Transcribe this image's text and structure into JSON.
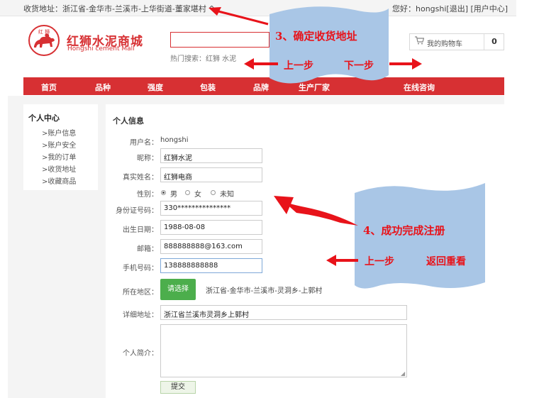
{
  "topbar": {
    "address_prefix": "收货地址：",
    "address": "浙江省-金华市-兰溪市-上华街道-董家堪村",
    "greeting": "您好：hongshi[退出] [用户中心]"
  },
  "logo": {
    "badge_text": "红 狮",
    "brand_cn": "红狮水泥商城",
    "brand_en": "Hongshi cement Mall"
  },
  "search": {
    "placeholder": "",
    "hot_label": "热门搜索：",
    "hot_terms": "红狮 水泥"
  },
  "cart": {
    "label": "我的购物车",
    "count": "0"
  },
  "nav": {
    "items": [
      "首页",
      "品种",
      "强度",
      "包装",
      "品牌",
      "生产厂家",
      "在线咨询"
    ]
  },
  "sidebar": {
    "title": "个人中心",
    "items": [
      ">账户信息",
      ">账户安全",
      ">我的订单",
      ">收货地址",
      ">收藏商品"
    ]
  },
  "form": {
    "section_title": "个人信息",
    "username_label": "用户名：",
    "username": "hongshi",
    "nickname_label": "昵称：",
    "nickname": "红狮水泥",
    "realname_label": "真实姓名：",
    "realname": "红狮电商",
    "gender_label": "性别：",
    "gender_options": [
      "男",
      "女",
      "未知"
    ],
    "gender_selected": "男",
    "idcard_label": "身份证号码：",
    "idcard": "330***************",
    "birth_label": "出生日期：",
    "birth": "1988-08-08",
    "email_label": "邮箱：",
    "email": "888888888@163.com",
    "phone_label": "手机号码：",
    "phone": "138888888888",
    "region_label": "所在地区：",
    "region_button": "请选择",
    "region_value": "浙江省-金华市-兰溪市-灵洞乡-上郭村",
    "address_label": "详细地址：",
    "address_value": "浙江省兰溪市灵洞乡上郭村",
    "intro_label": "个人简介：",
    "intro_value": "",
    "submit_label": "提交"
  },
  "annotations": {
    "step3_title": "3、确定收货地址",
    "step3_prev": "上一步",
    "step3_next": "下一步",
    "step4_title": "4、成功完成注册",
    "step4_prev": "上一步",
    "step4_back": "返回重看",
    "flag_color": "#a9c6e6",
    "arrow_color": "#e8131a"
  }
}
